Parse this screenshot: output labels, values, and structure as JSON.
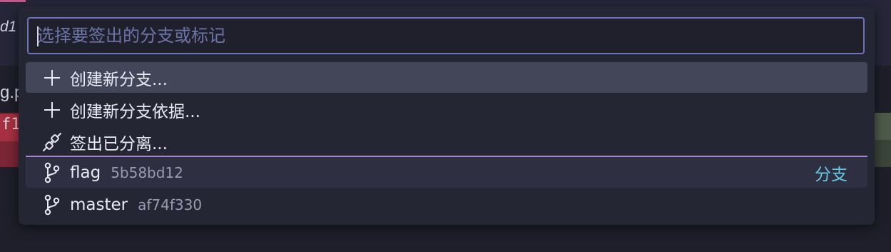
{
  "background": {
    "tab_text": "d1",
    "file_text": "g.p",
    "diff_text": "f1"
  },
  "quick_pick": {
    "placeholder": "选择要签出的分支或标记",
    "value": "",
    "items": [
      {
        "icon": "plus-icon",
        "label": "创建新分支...",
        "description": "",
        "detail": ""
      },
      {
        "icon": "plus-icon",
        "label": "创建新分支依据...",
        "description": "",
        "detail": ""
      },
      {
        "icon": "debug-disconnect-icon",
        "label": "签出已分离...",
        "description": "",
        "detail": ""
      },
      {
        "icon": "git-branch-icon",
        "label": "flag",
        "description": "5b58bd12",
        "detail": "分支"
      },
      {
        "icon": "git-branch-icon",
        "label": "master",
        "description": "af74f330",
        "detail": ""
      }
    ]
  },
  "colors": {
    "accent_border": "#6b76b8",
    "separator": "#a783d6",
    "detail_text": "#67c7e6",
    "active_row": "#434559"
  }
}
